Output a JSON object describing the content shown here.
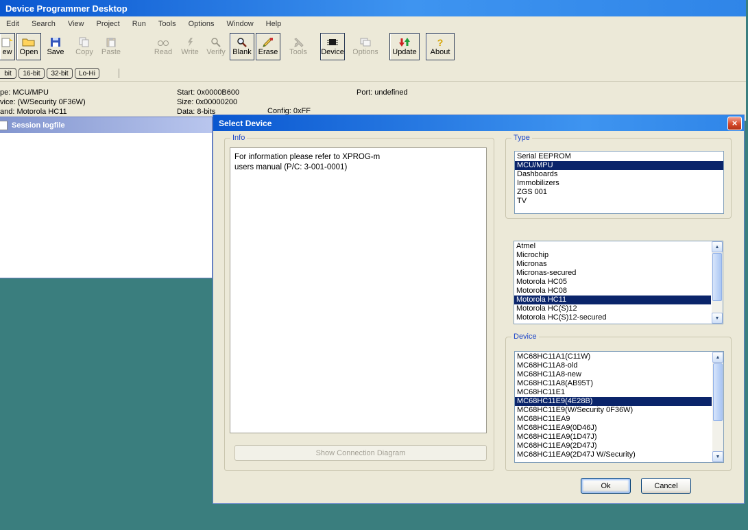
{
  "colors": {
    "desktop": "#3A7E7E",
    "titlebar_gradient_start": "#0A57D0",
    "titlebar_gradient_end": "#3E94F0",
    "selection": "#0A246A",
    "group_label": "#1E46C8",
    "chrome": "#ECE9D8"
  },
  "window": {
    "title": "Device Programmer Desktop"
  },
  "menu": {
    "items": [
      "Edit",
      "Search",
      "View",
      "Project",
      "Run",
      "Tools",
      "Options",
      "Window",
      "Help"
    ]
  },
  "toolbar": {
    "buttons": [
      {
        "label": "ew"
      },
      {
        "label": "Open"
      },
      {
        "label": "Save"
      },
      {
        "label": "Copy"
      },
      {
        "label": "Paste"
      },
      {
        "label": "Read"
      },
      {
        "label": "Write"
      },
      {
        "label": "Verify"
      },
      {
        "label": "Blank"
      },
      {
        "label": "Erase"
      },
      {
        "label": "Tools"
      },
      {
        "label": "Device"
      },
      {
        "label": "Options"
      },
      {
        "label": "Update"
      },
      {
        "label": "About"
      }
    ]
  },
  "format_toolbar": {
    "buttons": [
      "bit",
      "16-bit",
      "32-bit",
      "Lo-Hi"
    ]
  },
  "status": {
    "type": "pe: MCU/MPU",
    "device": "vice: (W/Security 0F36W)",
    "brand": "and: Motorola HC11",
    "start": "Start: 0x0000B600",
    "size": "Size: 0x00000200",
    "data": "Data: 8-bits",
    "config": "Config: 0xFF",
    "port": "Port: undefined"
  },
  "session_window": {
    "title": "Session logfile"
  },
  "icons": {
    "close": "×",
    "scroll_up": "▲",
    "scroll_down": "▼",
    "about": "?"
  },
  "dialog": {
    "title": "Select Device",
    "info": {
      "label": "Info",
      "lines": [
        "For information please refer to XPROG-m",
        "users manual (P/C: 3-001-0001)"
      ],
      "show_connection_button": "Show Connection Diagram"
    },
    "type_group": {
      "label": "Type",
      "items": [
        "Serial EEPROM",
        "MCU/MPU",
        "Dashboards",
        "Immobilizers",
        "ZGS 001",
        "TV"
      ],
      "selected_index": 1
    },
    "manufacturer_list": {
      "items": [
        "Atmel",
        "Microchip",
        "Micronas",
        "Micronas-secured",
        "Motorola HC05",
        "Motorola HC08",
        "Motorola HC11",
        "Motorola HC(S)12",
        "Motorola HC(S)12-secured"
      ],
      "selected_index": 6
    },
    "device_group": {
      "label": "Device",
      "items": [
        "MC68HC11A1(C11W)",
        "MC68HC11A8-old",
        "MC68HC11A8-new",
        "MC68HC11A8(AB95T)",
        "MC68HC11E1",
        "MC68HC11E9(4E28B)",
        "MC68HC11E9(W/Security 0F36W)",
        "MC68HC11EA9",
        "MC68HC11EA9(0D46J)",
        "MC68HC11EA9(1D47J)",
        "MC68HC11EA9(2D47J)",
        "MC68HC11EA9(2D47J W/Security)"
      ],
      "selected_index": 5
    },
    "buttons": {
      "ok": "Ok",
      "cancel": "Cancel"
    }
  }
}
